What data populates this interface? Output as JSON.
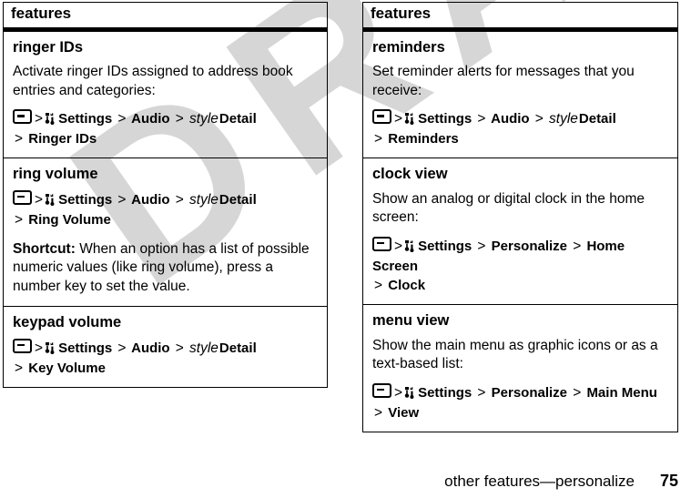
{
  "page": {
    "footer_label": "other features—personalize",
    "footer_page_number": "75",
    "watermark_text": "DRAFT",
    "watermark_color": "#d6d6d6",
    "text_color": "#000000",
    "background_color": "#ffffff"
  },
  "icons": {
    "menu_key": "menu-key-icon",
    "settings": "settings-tools-icon"
  },
  "columns": {
    "left": {
      "header": "features",
      "rows": [
        {
          "title": "ringer IDs",
          "desc": "Activate ringer IDs assigned to address book entries and categories:",
          "path": {
            "segments": [
              "Settings",
              "Audio",
              "Detail"
            ],
            "style_word": "style",
            "final": "Ringer IDs"
          }
        },
        {
          "title": "ring volume",
          "desc": "",
          "path": {
            "segments": [
              "Settings",
              "Audio",
              "Detail"
            ],
            "style_word": "style",
            "final": "Ring Volume"
          },
          "note_lead": "Shortcut:",
          "note_body": " When an option has a list of possible numeric values (like ring volume), press a number key to set the value."
        },
        {
          "title": "keypad volume",
          "desc": "",
          "path": {
            "segments": [
              "Settings",
              "Audio",
              "Detail"
            ],
            "style_word": "style",
            "final": "Key Volume"
          }
        }
      ]
    },
    "right": {
      "header": "features",
      "rows": [
        {
          "title": "reminders",
          "desc": "Set reminder alerts for messages that you receive:",
          "path": {
            "segments": [
              "Settings",
              "Audio",
              "Detail"
            ],
            "style_word": "style",
            "final": "Reminders"
          }
        },
        {
          "title": "clock view",
          "desc": "Show an analog or digital clock in the home screen:",
          "path": {
            "segments": [
              "Settings",
              "Personalize",
              "Home Screen"
            ],
            "style_word": "",
            "final": "Clock"
          }
        },
        {
          "title": "menu view",
          "desc": "Show the main menu as graphic icons or as a text-based list:",
          "path": {
            "segments": [
              "Settings",
              "Personalize",
              "Main Menu"
            ],
            "style_word": "",
            "final": "View"
          }
        }
      ]
    }
  }
}
